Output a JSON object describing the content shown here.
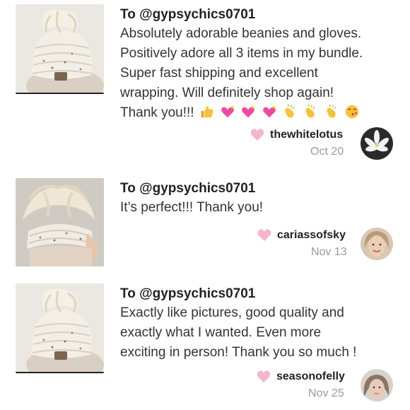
{
  "reviews": [
    {
      "to": "To @gypsychics0701",
      "lines": [
        "Absolutely adorable beanies and gloves.",
        "Positively adore all 3 items in my bundle.",
        "Super fast shipping and excellent",
        "wrapping. Will definitely shop again!",
        "Thank you!!!"
      ],
      "emojis": [
        "thumbs-up-icon",
        "sparkling-heart-icon",
        "sparkling-heart-icon",
        "sparkling-heart-icon",
        "clapping-hands-icon",
        "clapping-hands-icon",
        "clapping-hands-icon",
        "kissing-face-icon"
      ],
      "username": "thewhitelotus",
      "date": "Oct 20"
    },
    {
      "to": "To @gypsychics0701",
      "lines": [
        "It’s perfect!!! Thank you!"
      ],
      "username": "cariassofsky",
      "date": "Nov 13"
    },
    {
      "to": "To @gypsychics0701",
      "lines": [
        "Exactly like pictures, good quality and",
        "exactly what I wanted. Even more",
        "exciting in person! Thank you so much !"
      ],
      "username": "seasonofelly",
      "date": "Nov 25"
    }
  ],
  "colors": {
    "heart": "#f7b6c8",
    "date": "#9a9a9a"
  }
}
